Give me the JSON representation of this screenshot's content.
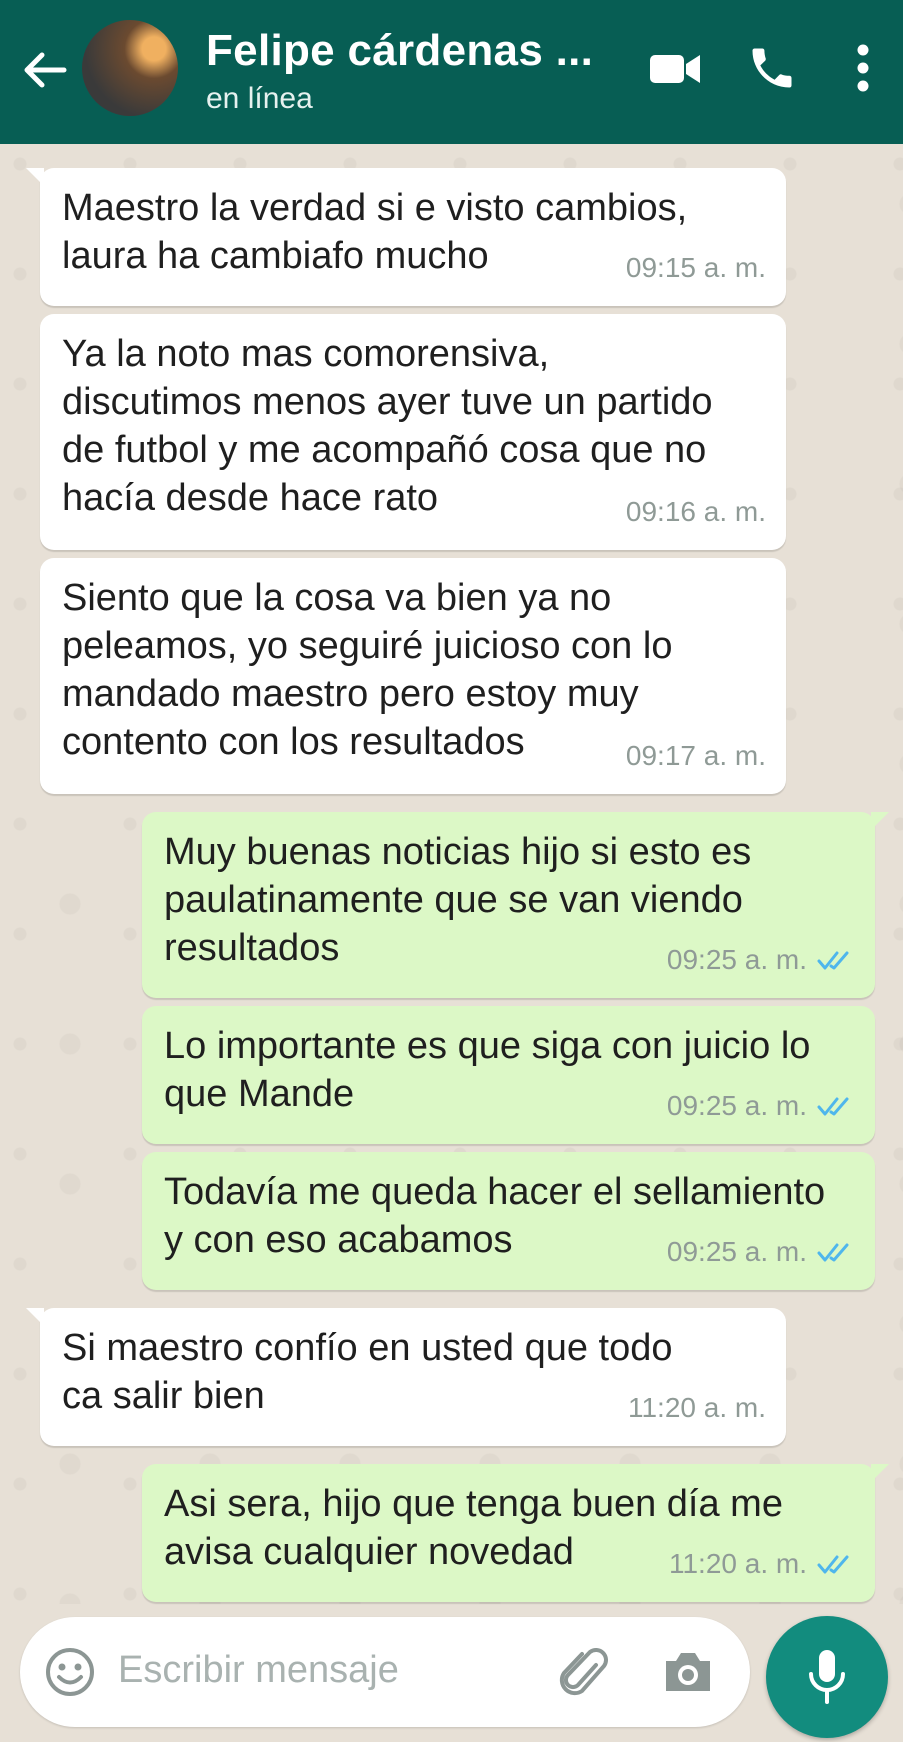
{
  "header": {
    "contact_name": "Felipe cárdenas ...",
    "status": "en línea"
  },
  "messages": [
    {
      "direction": "in",
      "text": "Maestro la verdad si e visto cambios,\nlaura ha cambiafo mucho",
      "time": "09:15 a. m."
    },
    {
      "direction": "in",
      "text": "Ya la noto mas comorensiva,\ndiscutimos menos ayer tuve un partido\nde futbol y me acompañó cosa que no\nhacía desde hace rato",
      "time": "09:16 a. m."
    },
    {
      "direction": "in",
      "text": "Siento que la cosa va bien ya no\npeleamos, yo seguiré juicioso con lo\nmandado maestro pero estoy muy\ncontento con los resultados",
      "time": "09:17 a. m."
    },
    {
      "direction": "out",
      "text": "Muy buenas noticias hijo si esto es\npaulatinamente que se van viendo\nresultados",
      "time": "09:25 a. m.",
      "status": "read"
    },
    {
      "direction": "out",
      "text": "Lo importante es que siga con juicio lo\nque Mande",
      "time": "09:25 a. m.",
      "status": "read"
    },
    {
      "direction": "out",
      "text": "Todavía me queda hacer el sellamiento\ny con eso acabamos",
      "time": "09:25 a. m.",
      "status": "read"
    },
    {
      "direction": "in",
      "text": "Si maestro  confío en usted que todo\nca salir bien",
      "time": "11:20 a. m."
    },
    {
      "direction": "out",
      "text": "Asi sera, hijo que tenga buen día me\navisa cualquier novedad",
      "time": "11:20 a. m.",
      "status": "read"
    }
  ],
  "composer": {
    "placeholder": "Escribir mensaje"
  },
  "colors": {
    "header": "#075e54",
    "outgoing_bubble": "#dcf8c6",
    "incoming_bubble": "#ffffff",
    "read_ticks": "#4fb6ec",
    "mic_button": "#128c7e"
  }
}
